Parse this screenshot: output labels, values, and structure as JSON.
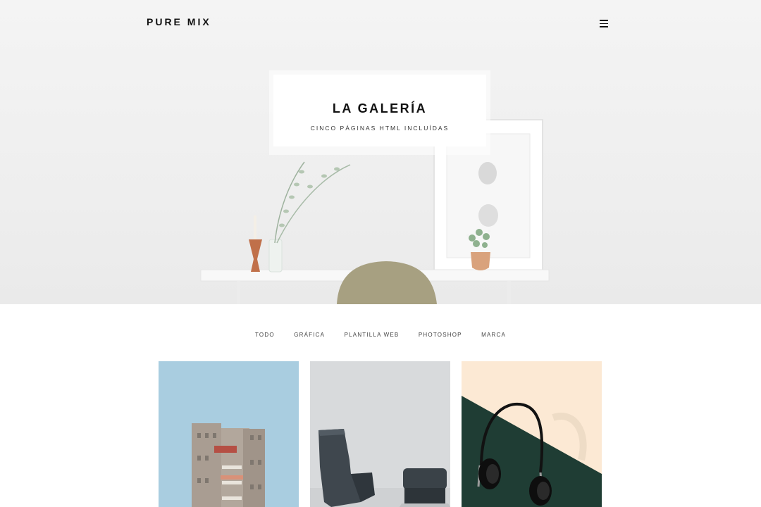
{
  "header": {
    "brand": "PURE MIX",
    "menu_icon": "hamburger-icon"
  },
  "hero": {
    "title": "LA GALERÍA",
    "subtitle": "CINCO PÁGINAS HTML INCLUÍDAS"
  },
  "filters": [
    "TODO",
    "GRÁFICA",
    "PLANTILLA WEB",
    "PHOTOSHOP",
    "MARCA"
  ],
  "gallery": [
    {
      "subject": "building",
      "background": "#a9cde0"
    },
    {
      "subject": "chairs",
      "background": "#d8dadc"
    },
    {
      "subject": "headphones",
      "background": "#fce9d4"
    }
  ]
}
